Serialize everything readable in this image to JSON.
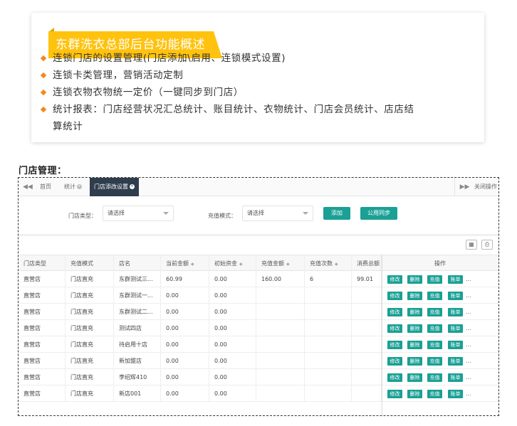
{
  "card": {
    "banner": "东群洗衣总部后台功能概述",
    "features": [
      "连锁门店的设置管理(门店添加\\启用、连锁模式设置)",
      "连锁卡类管理，营销活动定制",
      "连锁衣物衣物统一定价（一键同步到门店）",
      "统计报表：门店经营状况汇总统计、账目统计、衣物统计、门店会员统计、店店结",
      "算统计"
    ]
  },
  "section_title": "门店管理：",
  "tabs": {
    "home": "首页",
    "stats": "统计",
    "store_settings": "门店添改设置",
    "close_ops": "关闭操作"
  },
  "filters": {
    "store_type_label": "门店类型：",
    "store_type_value": "请选择",
    "recharge_mode_label": "充值模式：",
    "recharge_mode_value": "请选择",
    "add_button": "添加",
    "sync_button": "公用同步"
  },
  "table": {
    "headers": [
      "门店类型",
      "充值模式",
      "店名",
      "当前金额",
      "初始资金",
      "充值金额",
      "充值次数",
      "消费总额",
      "操作"
    ],
    "row_actions": [
      "修改",
      "删除",
      "充值",
      "账单",
      "..."
    ],
    "rows": [
      [
        "直营店",
        "门店直充",
        "东群测试三...",
        "60.99",
        "0.00",
        "160.00",
        "6",
        "99.01"
      ],
      [
        "直营店",
        "门店直充",
        "东群测试一...",
        "0.00",
        "0.00",
        "",
        "",
        ""
      ],
      [
        "直营店",
        "门店直充",
        "东群测试二...",
        "0.00",
        "0.00",
        "",
        "",
        ""
      ],
      [
        "直营店",
        "门店直充",
        "测试四店",
        "0.00",
        "0.00",
        "",
        "",
        ""
      ],
      [
        "直营店",
        "门店直充",
        "待启用十店",
        "0.00",
        "0.00",
        "",
        "",
        ""
      ],
      [
        "直营店",
        "门店直充",
        "新加盟店",
        "0.00",
        "0.00",
        "",
        "",
        ""
      ],
      [
        "直营店",
        "门店直充",
        "李绍辉410",
        "0.00",
        "0.00",
        "",
        "",
        ""
      ],
      [
        "直营店",
        "门店直充",
        "新店001",
        "0.00",
        "0.00",
        "",
        "",
        ""
      ]
    ]
  },
  "colors": {
    "banner": "#ffc20e",
    "bullet": "#f08a24",
    "button": "#1aa094",
    "active_tab": "#2f3d4d"
  }
}
